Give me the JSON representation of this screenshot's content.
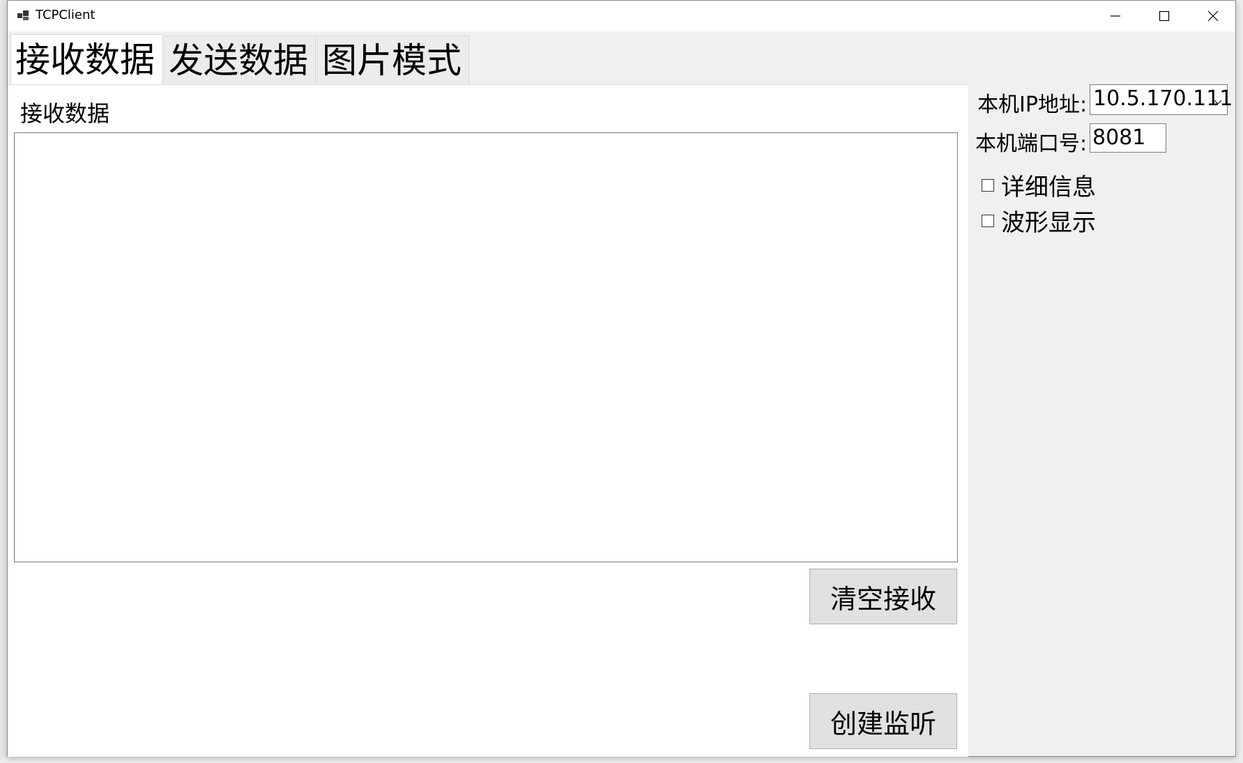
{
  "window": {
    "title": "TCPClient",
    "controls": [
      "minimize-icon",
      "maximize-icon",
      "close-icon"
    ]
  },
  "tabs": [
    {
      "label": "接收数据",
      "active": true
    },
    {
      "label": "发送数据",
      "active": false
    },
    {
      "label": "图片模式",
      "active": false
    }
  ],
  "receive_panel": {
    "label": "接收数据",
    "content": ""
  },
  "buttons": {
    "clear_label": "清空接收",
    "listen_label": "创建监听"
  },
  "settings": {
    "ip_label": "本机IP地址:",
    "ip_value": "10.5.170.111",
    "port_label": "本机端口号:",
    "port_value": "8081",
    "detail_label": "详细信息",
    "detail_checked": false,
    "waveform_label": "波形显示",
    "waveform_checked": false
  }
}
